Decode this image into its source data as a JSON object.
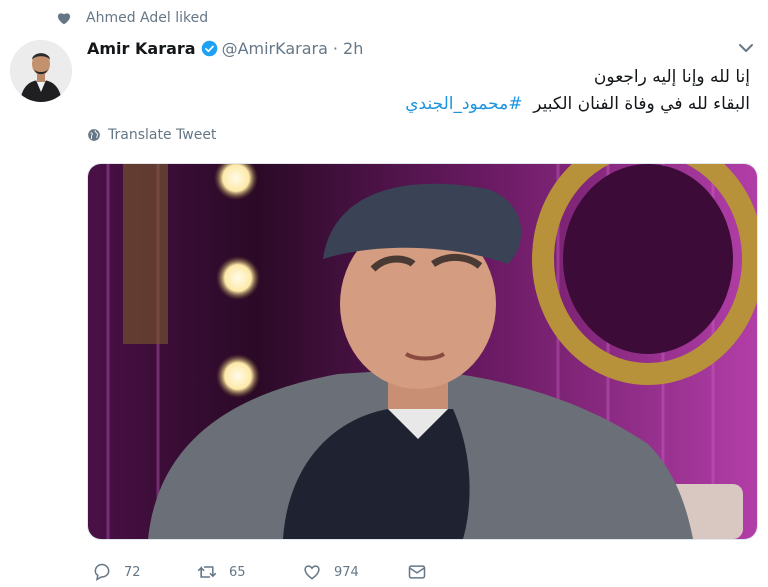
{
  "liked_by": "Ahmed Adel liked",
  "tweet": {
    "author_name": "Amir Karara",
    "handle": "@AmirKarara",
    "separator": "·",
    "time": "2h",
    "text_line1": "إنا لله وإنا إليه راجعون",
    "text_line2": "البقاء لله في وفاة الفنان الكبير",
    "hashtag": "#محمود_الجندي",
    "translate": "Translate Tweet"
  },
  "actions": {
    "replies": "72",
    "retweets": "65",
    "likes": "974"
  },
  "colors": {
    "link": "#1b95e0",
    "verified": "#1da1f2",
    "muted": "#657786"
  }
}
